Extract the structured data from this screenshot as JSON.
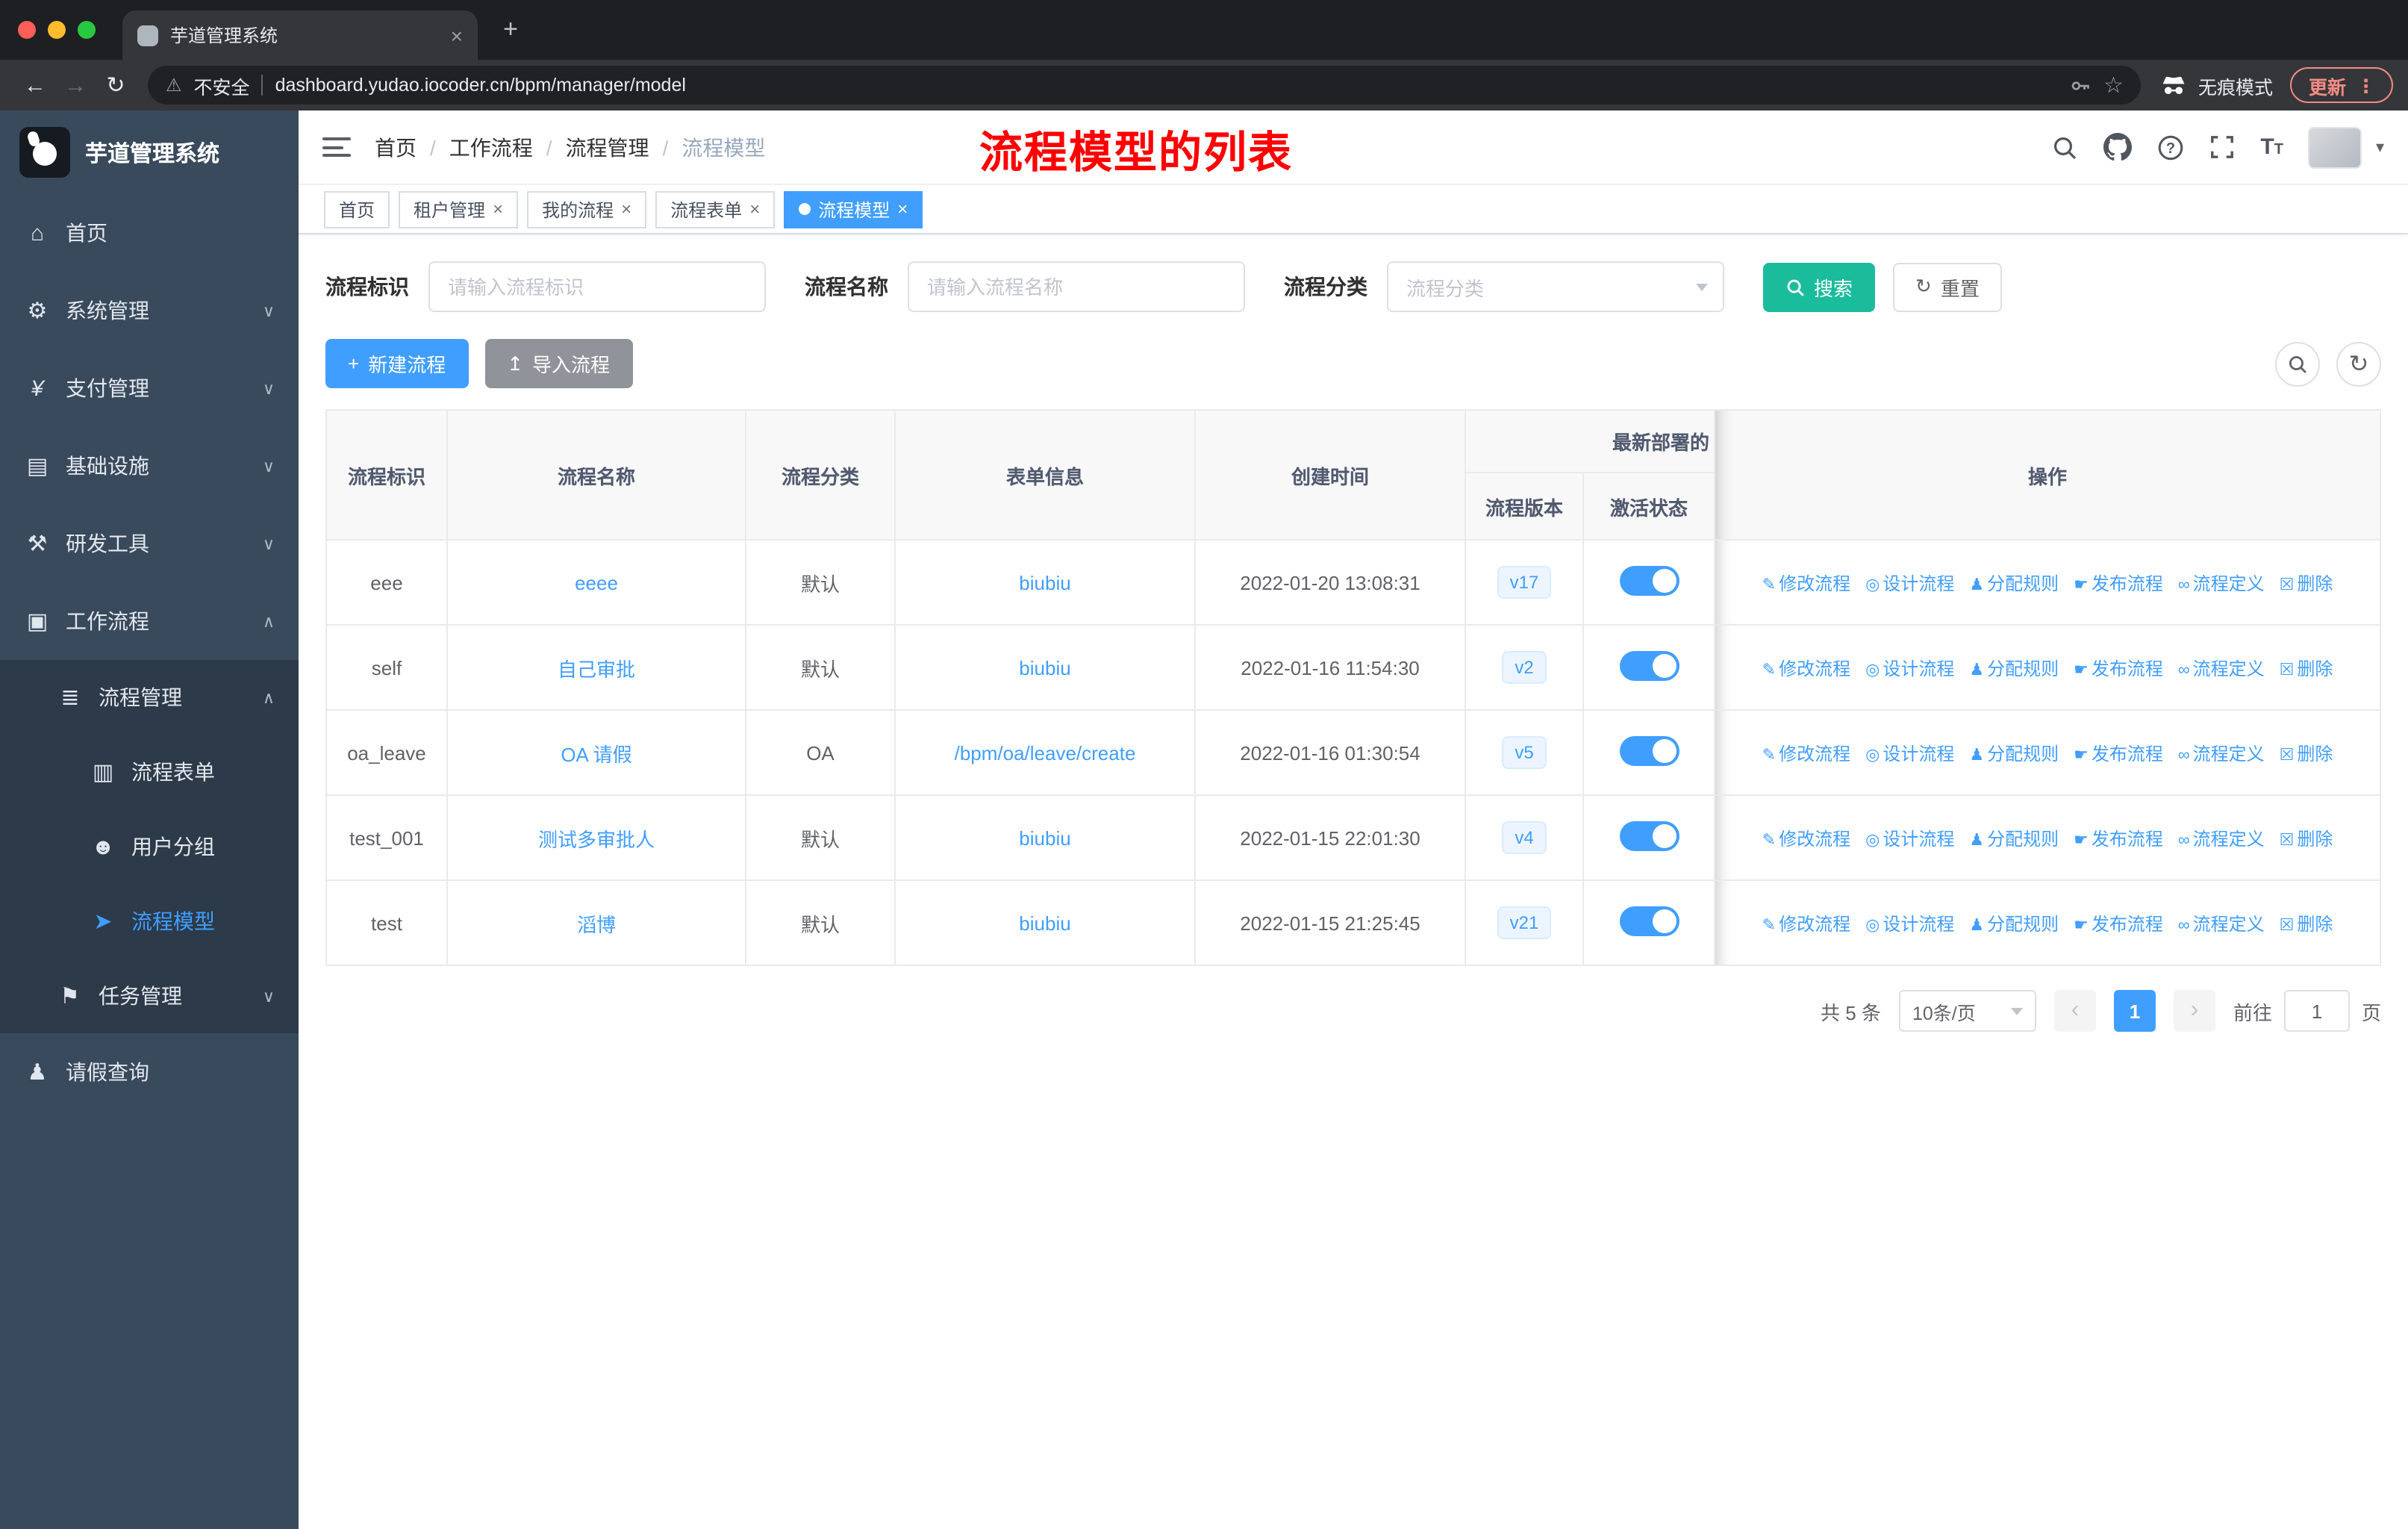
{
  "colors": {
    "accent": "#409EFF",
    "search_button": "#1ABC9C",
    "annotation_red": "#FE0000",
    "sidebar_bg": "#3A4A5D",
    "submenu_bg": "#2D3A49"
  },
  "browser": {
    "tab_title": "芋道管理系统",
    "security_label": "不安全",
    "url": "dashboard.yudao.iocoder.cn/bpm/manager/model",
    "incognito_label": "无痕模式",
    "update_label": "更新"
  },
  "sidebar": {
    "app_title": "芋道管理系统",
    "items": [
      {
        "label": "首页"
      },
      {
        "label": "系统管理"
      },
      {
        "label": "支付管理"
      },
      {
        "label": "基础设施"
      },
      {
        "label": "研发工具"
      },
      {
        "label": "工作流程"
      },
      {
        "label": "流程管理"
      },
      {
        "label": "流程表单"
      },
      {
        "label": "用户分组"
      },
      {
        "label": "流程模型"
      },
      {
        "label": "任务管理"
      },
      {
        "label": "请假查询"
      }
    ]
  },
  "header": {
    "breadcrumb": [
      "首页",
      "工作流程",
      "流程管理",
      "流程模型"
    ],
    "annotation": "流程模型的列表"
  },
  "tags": [
    {
      "label": "首页"
    },
    {
      "label": "租户管理"
    },
    {
      "label": "我的流程"
    },
    {
      "label": "流程表单"
    },
    {
      "label": "流程模型"
    }
  ],
  "filters": {
    "id_label": "流程标识",
    "id_placeholder": "请输入流程标识",
    "name_label": "流程名称",
    "name_placeholder": "请输入流程名称",
    "category_label": "流程分类",
    "category_placeholder": "流程分类",
    "search_label": "搜索",
    "reset_label": "重置"
  },
  "toolbar": {
    "create_label": "新建流程",
    "import_label": "导入流程"
  },
  "table": {
    "headers": {
      "id": "流程标识",
      "name": "流程名称",
      "category": "流程分类",
      "form": "表单信息",
      "created": "创建时间",
      "group": "最新部署的",
      "version": "流程版本",
      "status": "激活状态",
      "actions": "操作"
    },
    "actions": [
      {
        "label": "修改流程"
      },
      {
        "label": "设计流程"
      },
      {
        "label": "分配规则"
      },
      {
        "label": "发布流程"
      },
      {
        "label": "流程定义"
      },
      {
        "label": "删除"
      }
    ],
    "rows": [
      {
        "id": "eee",
        "name": "eeee",
        "category": "默认",
        "form": "biubiu",
        "created": "2022-01-20 13:08:31",
        "version": "v17"
      },
      {
        "id": "self",
        "name": "自己审批",
        "category": "默认",
        "form": "biubiu",
        "created": "2022-01-16 11:54:30",
        "version": "v2"
      },
      {
        "id": "oa_leave",
        "name": "OA 请假",
        "category": "OA",
        "form": "/bpm/oa/leave/create",
        "created": "2022-01-16 01:30:54",
        "version": "v5"
      },
      {
        "id": "test_001",
        "name": "测试多审批人",
        "category": "默认",
        "form": "biubiu",
        "created": "2022-01-15 22:01:30",
        "version": "v4"
      },
      {
        "id": "test",
        "name": "滔博",
        "category": "默认",
        "form": "biubiu",
        "created": "2022-01-15 21:25:45",
        "version": "v21"
      }
    ]
  },
  "pagination": {
    "total": "共 5 条",
    "page_size": "10条/页",
    "current_page": "1",
    "goto_label": "前往",
    "goto_value": "1",
    "page_unit": "页"
  }
}
